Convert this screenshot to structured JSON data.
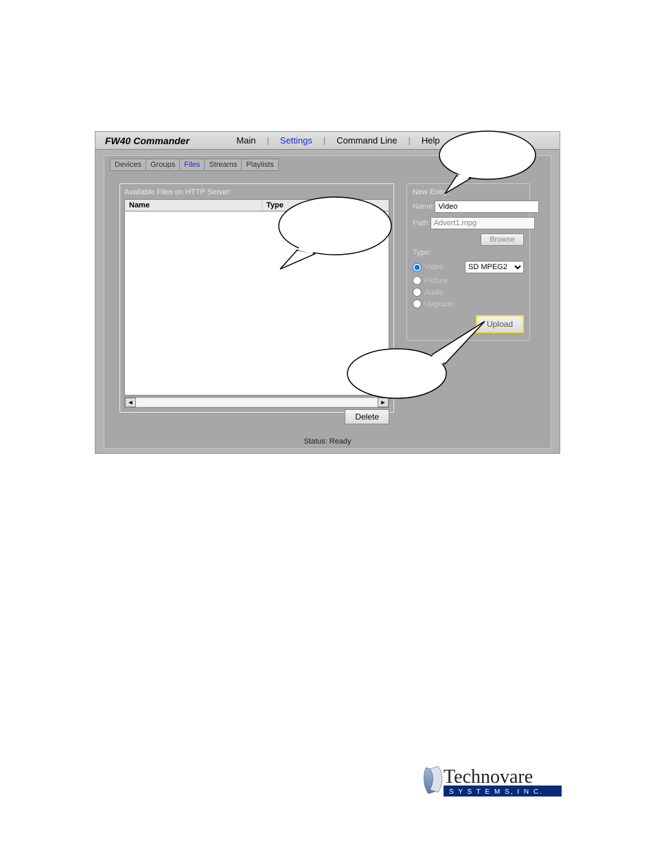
{
  "app_title": "FW40 Commander",
  "menu": {
    "main": "Main",
    "settings": "Settings",
    "command_line": "Command Line",
    "help": "Help"
  },
  "tabs": {
    "devices": "Devices",
    "groups": "Groups",
    "files": "Files",
    "streams": "Streams",
    "playlists": "Playlists"
  },
  "filelist": {
    "title": "Available Files on HTTP Server:",
    "col_name": "Name",
    "col_type": "Type",
    "delete_label": "Delete"
  },
  "new_entry": {
    "title": "New Entry:",
    "name_label": "Name:",
    "name_value": "Video",
    "path_label": "Path:",
    "path_value": "Advert1.mpg",
    "browse_label": "Browse",
    "type_label": "Type:",
    "radio_video": "Video",
    "radio_picture": "Picture",
    "radio_audio": "Audio",
    "radio_upgrade": "Upgrade",
    "codec": "SD MPEG2",
    "upload_label": "Upload"
  },
  "status": {
    "label": "Status:",
    "value": "Ready"
  },
  "logo": {
    "brand": "Technovare",
    "sub": "S Y S T E M S,   I N C."
  }
}
